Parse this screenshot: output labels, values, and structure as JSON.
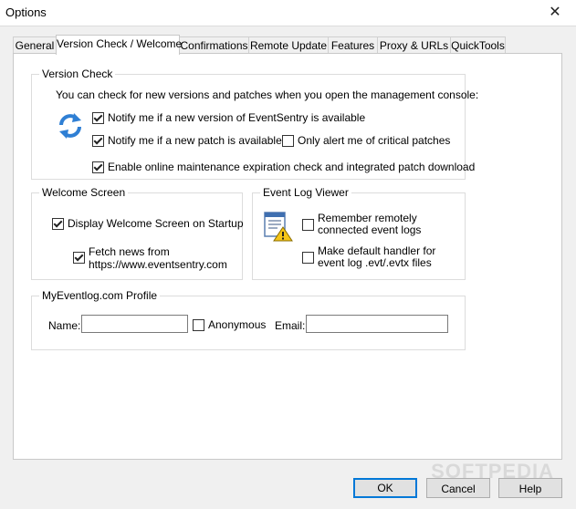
{
  "window": {
    "title": "Options",
    "close_glyph": "✕"
  },
  "tabs": [
    {
      "label": "General"
    },
    {
      "label": "Version Check / Welcome"
    },
    {
      "label": "Confirmations"
    },
    {
      "label": "Remote Update"
    },
    {
      "label": "Features"
    },
    {
      "label": "Proxy & URLs"
    },
    {
      "label": "QuickTools"
    }
  ],
  "version_check": {
    "title": "Version Check",
    "intro": "You can check for new versions and patches when you open the management console:",
    "icon": "refresh-icon",
    "notify_version": {
      "label": "Notify me if a new version of EventSentry is available",
      "checked": true
    },
    "notify_patch": {
      "label": "Notify me if a new patch is available",
      "checked": true
    },
    "critical_only": {
      "label": "Only alert me of critical patches",
      "checked": false
    },
    "maintenance": {
      "label": "Enable online maintenance expiration check and integrated patch download",
      "checked": true
    }
  },
  "welcome": {
    "title": "Welcome Screen",
    "display_startup": {
      "label": "Display Welcome Screen on Startup",
      "checked": true
    },
    "fetch_news": {
      "line1": "Fetch news from",
      "line2": "https://www.eventsentry.com",
      "checked": true
    }
  },
  "eventlog": {
    "title": "Event Log Viewer",
    "icon": "event-log-warning-icon",
    "remember": {
      "line1": "Remember remotely",
      "line2": "connected event logs",
      "checked": false
    },
    "default_handler": {
      "line1": "Make default handler for",
      "line2": "event log .evt/.evtx files",
      "checked": false
    }
  },
  "profile": {
    "title": "MyEventlog.com Profile",
    "name_label": "Name:",
    "name_value": "",
    "anonymous": {
      "label": "Anonymous",
      "checked": false
    },
    "email_label": "Email:",
    "email_value": ""
  },
  "buttons": {
    "ok": "OK",
    "cancel": "Cancel",
    "help": "Help"
  },
  "watermark": "SOFTPEDIA"
}
